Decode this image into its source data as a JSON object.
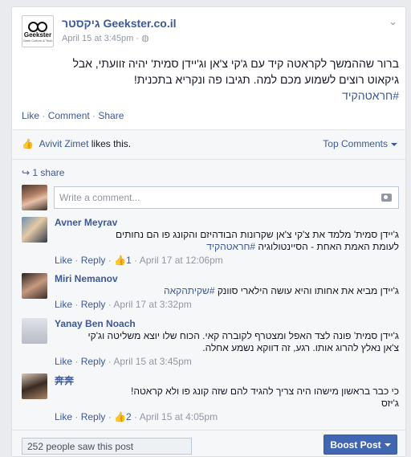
{
  "post": {
    "page_name": "גיקסטר Geekster.co.il",
    "logo_text": "Geekster",
    "logo_sub": "Geek Culture & Tech",
    "time": "April 15 at 3:45pm",
    "audience_icon": "globe-icon",
    "text_line1": "ברור שההמשך לקראטה קיד עם ג'קי צ'אן וג'יידן סמית' יהיה זוועתי, אבל",
    "text_line2": "גיקאוט רוצים לשמוע מכם למה. תגיבו פה ונקריא בתכנית!",
    "hashtag": "#חראטהקיד"
  },
  "actions": {
    "like": "Like",
    "comment": "Comment",
    "share": "Share"
  },
  "feedback": {
    "liker": "Avivit Zimet",
    "likes_suffix": " likes this.",
    "top_comments": "Top Comments",
    "shares": "1 share",
    "comment_placeholder": "Write a comment..."
  },
  "comments": [
    {
      "name": "Avner Meyrav",
      "line1": "ג'יידן סמית' מלמד את צ'קי צ'אן שקרונות הבודהיזם והקונג פו הם נחותים",
      "line2": "לעומת האמת האחת - הסיינטולוגיה ",
      "tag": "#חראטהקיד",
      "like": "Like",
      "reply": "Reply",
      "likes_count": "1",
      "time": "April 17 at 12:06pm"
    },
    {
      "name": "Miri Nemanov",
      "line1": "ג'יידן מביא את אחותו והיא עושה הילארי סוונק ",
      "tag": "#שקיתהקאה",
      "like": "Like",
      "reply": "Reply",
      "time": "April 17 at 3:32pm"
    },
    {
      "name": "Yanay Ben Noach",
      "line1": "ג'יידן סמית' פונה לצד האפל ומצטרף לקוברה קאי. הכוח שלו יוצא משליטה וג'קי",
      "line2": "צ'אן נאלץ להרוג אותו. רגע, זה דווקא נשמע אחלה.",
      "like": "Like",
      "reply": "Reply",
      "time": "April 15 at 3:45pm"
    },
    {
      "name": "奔奔",
      "line1": "כי כבר בראשון מישהו היה צריך להגיד להם שזה קונג פו ולא קראטה!",
      "line2": "ג'יזס",
      "like": "Like",
      "reply": "Reply",
      "likes_count": "2",
      "time": "April 15 at 4:05pm"
    }
  ],
  "footer": {
    "seen": "252 people saw this post",
    "boost": "Boost Post"
  },
  "colors": {
    "link": "#3b5998",
    "boost_bg": "#4267b2",
    "muted": "#9197a3"
  }
}
